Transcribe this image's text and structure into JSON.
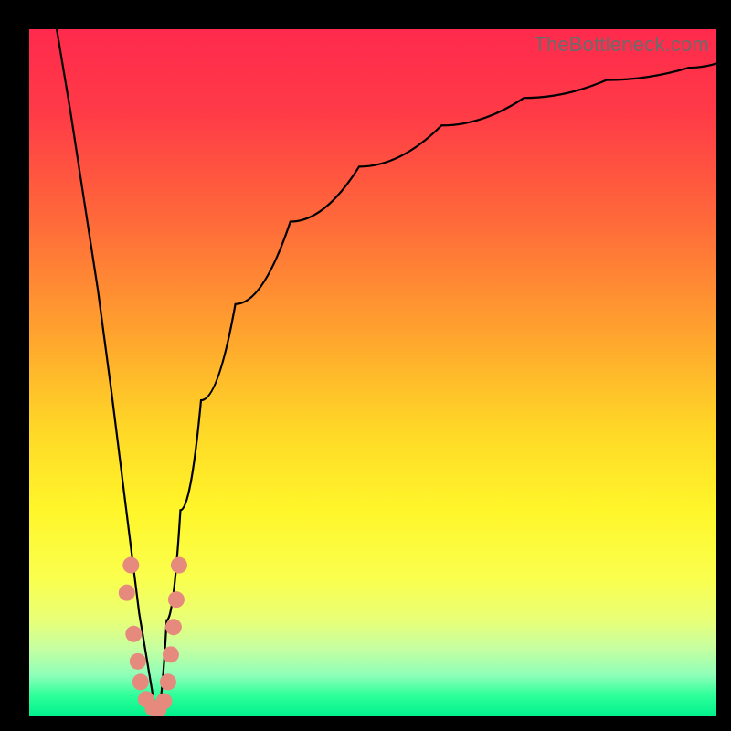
{
  "watermark": "TheBottleneck.com",
  "colors": {
    "frame": "#000000",
    "curve": "#000000",
    "dot": "#e78a7e",
    "gradient_stops": [
      "#ff2a4d",
      "#ff6a3a",
      "#ffd727",
      "#fff62a",
      "#2dff9a",
      "#00f08c"
    ]
  },
  "chart_data": {
    "type": "line",
    "title": "",
    "xlabel": "",
    "ylabel": "",
    "xrange": [
      0,
      100
    ],
    "yrange": [
      0,
      100
    ],
    "grid": false,
    "legend": false,
    "series": [
      {
        "name": "left-branch",
        "x": [
          4,
          6,
          8,
          10,
          12,
          14,
          16,
          18.5
        ],
        "y": [
          100,
          88,
          75,
          62,
          47,
          31,
          15,
          0
        ]
      },
      {
        "name": "right-branch",
        "x": [
          18.5,
          20,
          22,
          25,
          30,
          38,
          48,
          60,
          72,
          84,
          96,
          100
        ],
        "y": [
          0,
          14,
          30,
          46,
          60,
          72,
          80,
          86,
          90,
          92.6,
          94.4,
          95
        ]
      }
    ],
    "points": [
      {
        "name": "cluster-dot",
        "x": 14.8,
        "y": 22
      },
      {
        "name": "cluster-dot",
        "x": 14.2,
        "y": 18
      },
      {
        "name": "cluster-dot",
        "x": 15.2,
        "y": 12
      },
      {
        "name": "cluster-dot",
        "x": 15.8,
        "y": 8
      },
      {
        "name": "cluster-dot",
        "x": 16.2,
        "y": 5
      },
      {
        "name": "cluster-dot",
        "x": 17.0,
        "y": 2.5
      },
      {
        "name": "cluster-dot",
        "x": 18.0,
        "y": 1.2
      },
      {
        "name": "cluster-dot",
        "x": 18.8,
        "y": 1.0
      },
      {
        "name": "cluster-dot",
        "x": 19.6,
        "y": 2.2
      },
      {
        "name": "cluster-dot",
        "x": 20.2,
        "y": 5
      },
      {
        "name": "cluster-dot",
        "x": 20.6,
        "y": 9
      },
      {
        "name": "cluster-dot",
        "x": 21.0,
        "y": 13
      },
      {
        "name": "cluster-dot",
        "x": 21.4,
        "y": 17
      },
      {
        "name": "cluster-dot",
        "x": 21.8,
        "y": 22
      }
    ]
  }
}
